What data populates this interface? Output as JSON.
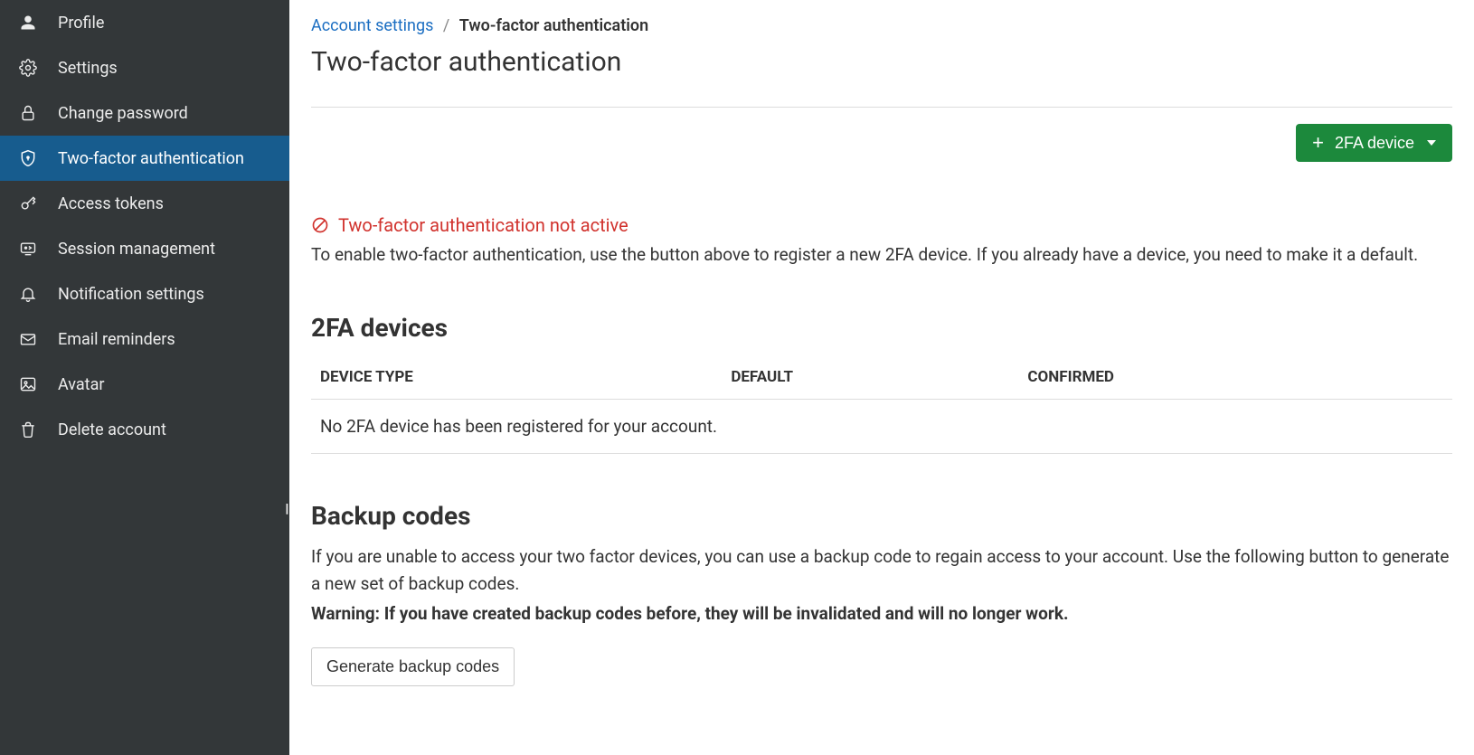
{
  "sidebar": {
    "items": [
      {
        "label": "Profile",
        "icon": "user-icon",
        "active": false
      },
      {
        "label": "Settings",
        "icon": "gear-icon",
        "active": false
      },
      {
        "label": "Change password",
        "icon": "lock-icon",
        "active": false
      },
      {
        "label": "Two-factor authentication",
        "icon": "shield-icon",
        "active": true
      },
      {
        "label": "Access tokens",
        "icon": "key-icon",
        "active": false
      },
      {
        "label": "Session management",
        "icon": "session-icon",
        "active": false
      },
      {
        "label": "Notification settings",
        "icon": "bell-icon",
        "active": false
      },
      {
        "label": "Email reminders",
        "icon": "mail-icon",
        "active": false
      },
      {
        "label": "Avatar",
        "icon": "image-icon",
        "active": false
      },
      {
        "label": "Delete account",
        "icon": "trash-icon",
        "active": false
      }
    ]
  },
  "breadcrumb": {
    "parent": "Account settings",
    "separator": "/",
    "current": "Two-factor authentication"
  },
  "page_title": "Two-factor authentication",
  "add_button": {
    "label": "2FA device"
  },
  "alert": {
    "title": "Two-factor authentication not active",
    "description": "To enable two-factor authentication, use the button above to register a new 2FA device. If you already have a device, you need to make it a default."
  },
  "devices": {
    "heading": "2FA devices",
    "columns": {
      "type": "DEVICE TYPE",
      "default": "DEFAULT",
      "confirmed": "CONFIRMED"
    },
    "empty_message": "No 2FA device has been registered for your account."
  },
  "backup": {
    "heading": "Backup codes",
    "description": "If you are unable to access your two factor devices, you can use a backup code to regain access to your account. Use the following button to generate a new set of backup codes.",
    "warning_label": "Warning:",
    "warning_text": "If you have created backup codes before, they will be invalidated and will no longer work.",
    "button_label": "Generate backup codes"
  }
}
